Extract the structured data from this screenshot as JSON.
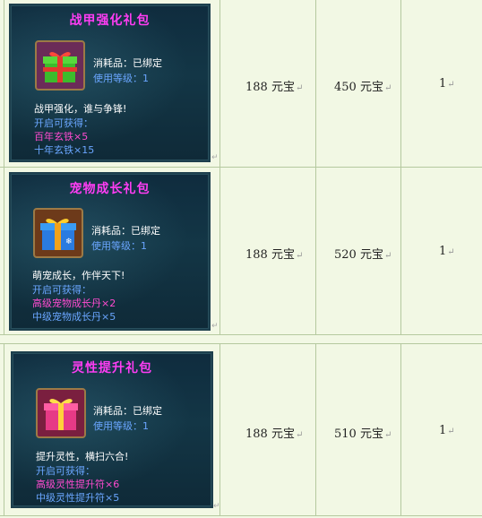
{
  "rows": [
    {
      "title": "战甲强化礼包",
      "type_label": "消耗品：已绑定",
      "level_label": "使用等级：1",
      "slogan": "战甲强化，谁与争锋!",
      "open_label": "开启可获得：",
      "item1": "百年玄铁×5",
      "item2": "十年玄铁×15",
      "price": "188 元宝",
      "original_price": "450 元宝",
      "quantity": "1",
      "icon": "green-gift-icon"
    },
    {
      "title": "宠物成长礼包",
      "type_label": "消耗品：已绑定",
      "level_label": "使用等级：1",
      "slogan": "萌宠成长，作伴天下!",
      "open_label": "开启可获得：",
      "item1": "高级宠物成长丹×2",
      "item2": "中级宠物成长丹×5",
      "price": "188 元宝",
      "original_price": "520 元宝",
      "quantity": "1",
      "icon": "blue-gift-icon"
    },
    {
      "title": "灵性提升礼包",
      "type_label": "消耗品：已绑定",
      "level_label": "使用等级：1",
      "slogan": "提升灵性，横扫六合!",
      "open_label": "开启可获得：",
      "item1": "高级灵性提升符×6",
      "item2": "中级灵性提升符×5",
      "price": "188 元宝",
      "original_price": "510 元宝",
      "quantity": "1",
      "icon": "pink-gift-icon"
    }
  ],
  "return_mark": "↵",
  "colors": {
    "title": "#ff3df4",
    "item_pink": "#ff4bd0",
    "item_blue": "#6aa6ff",
    "table_bg": "#f2f8e4",
    "border": "#b5c99f"
  }
}
